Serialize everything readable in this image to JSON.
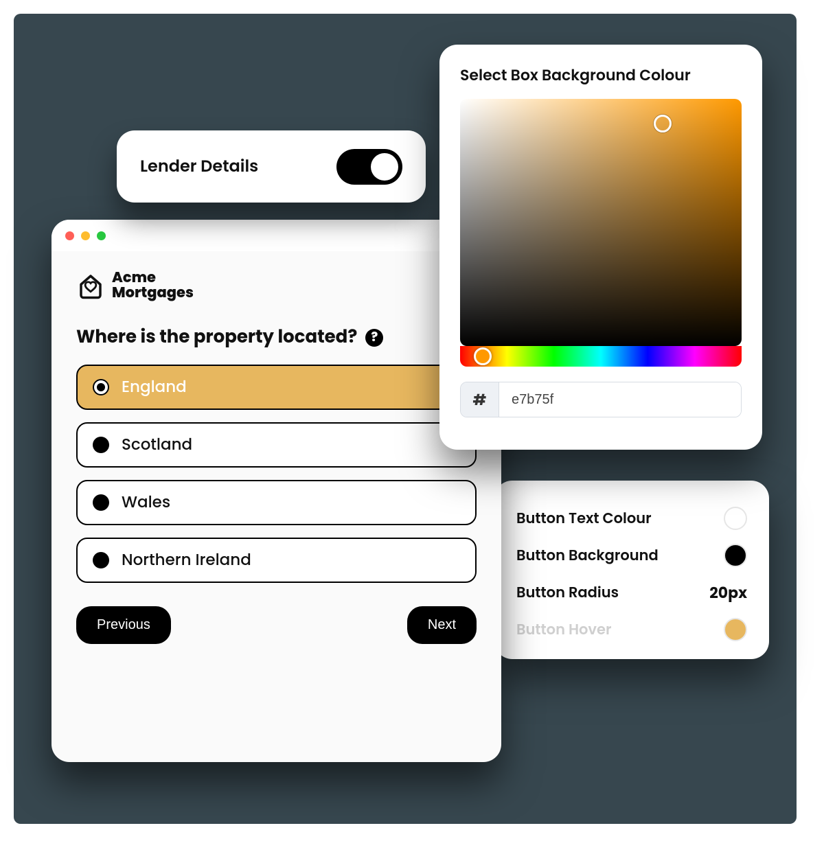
{
  "lender": {
    "label": "Lender Details",
    "enabled": true
  },
  "app": {
    "logo": {
      "line1": "Acme",
      "line2": "Mortgages"
    },
    "question": "Where is the property located?",
    "options": [
      {
        "label": "England",
        "selected": true
      },
      {
        "label": "Scotland",
        "selected": false
      },
      {
        "label": "Wales",
        "selected": false
      },
      {
        "label": "Northern Ireland",
        "selected": false
      }
    ],
    "prev": "Previous",
    "next": "Next"
  },
  "picker": {
    "title": "Select Box Background Colour",
    "hash": "#",
    "hex": "e7b75f"
  },
  "styles": {
    "rows": [
      {
        "label": "Button Text Colour",
        "type": "swatch",
        "color": "#ffffff"
      },
      {
        "label": "Button Background",
        "type": "swatch",
        "color": "#000000"
      },
      {
        "label": "Button Radius",
        "type": "text",
        "value": "20px"
      },
      {
        "label": "Button Hover",
        "type": "swatch",
        "color": "#e7b75f",
        "faded": true
      }
    ]
  },
  "colors": {
    "accent": "#e7b75f",
    "stage": "#37474f"
  }
}
